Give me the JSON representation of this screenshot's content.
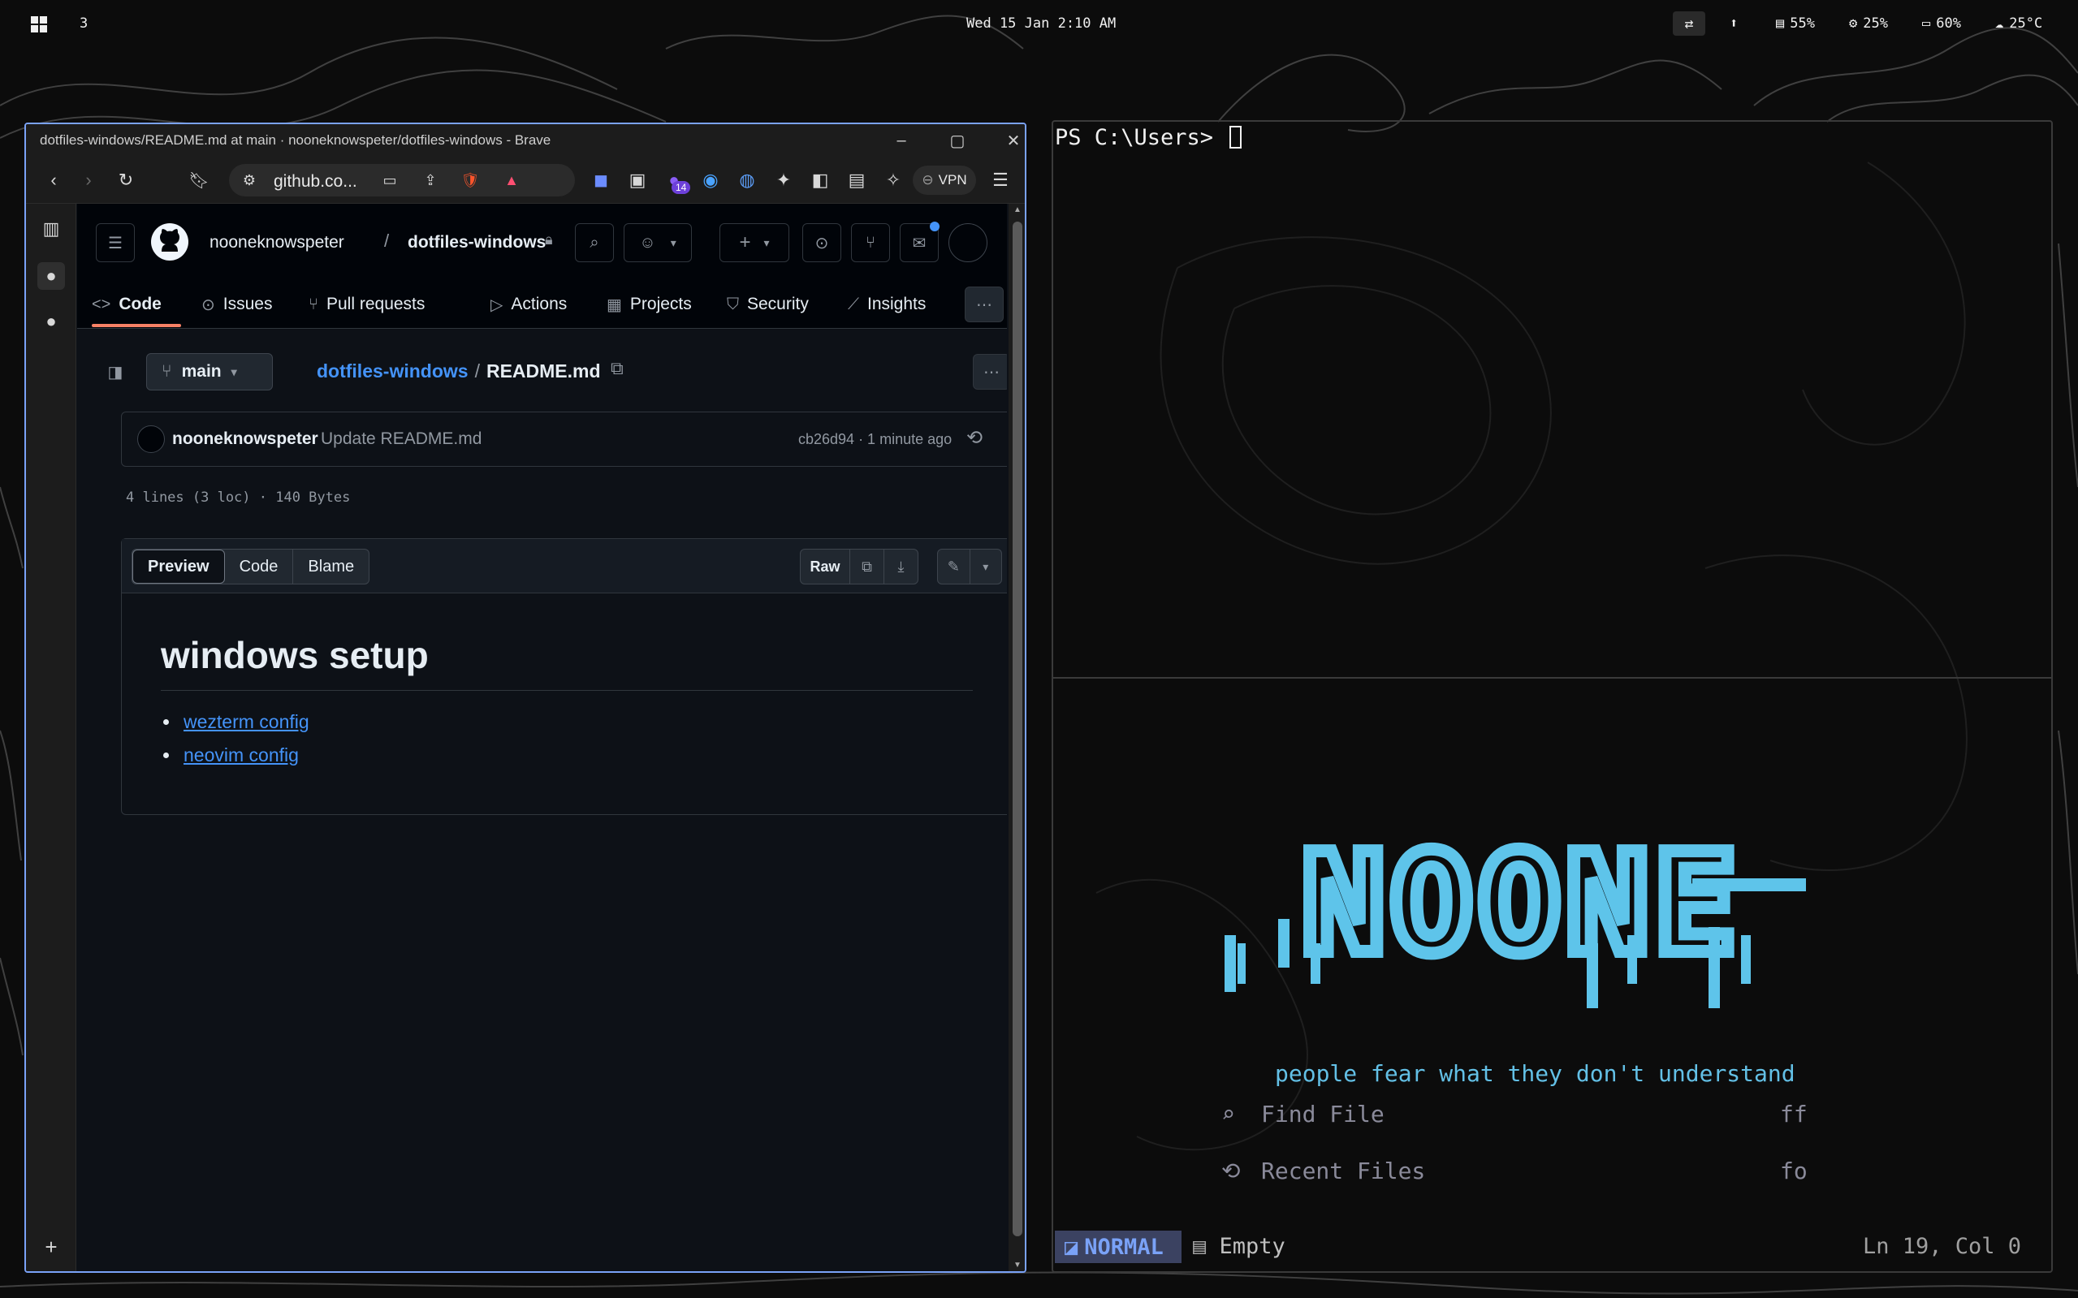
{
  "topbar": {
    "workspace": "3",
    "clock": "Wed 15 Jan 2:10 AM",
    "memory": "55%",
    "cpu": "25%",
    "battery": "60%",
    "weather": "25°C"
  },
  "browser": {
    "window_title": "dotfiles-windows/README.md at main · nooneknowspeter/dotfiles-windows - Brave",
    "url": "github.co...",
    "vpn_label": "VPN",
    "extension_badge": "14"
  },
  "github": {
    "owner": "nooneknowspeter",
    "repo": "dotfiles-windows",
    "tabs": [
      {
        "label": "Code"
      },
      {
        "label": "Issues"
      },
      {
        "label": "Pull requests"
      },
      {
        "label": "Actions"
      },
      {
        "label": "Projects"
      },
      {
        "label": "Security"
      },
      {
        "label": "Insights"
      }
    ],
    "branch": "main",
    "breadcrumb_repo": "dotfiles-windows",
    "breadcrumb_sep": "/",
    "breadcrumb_file": "README.md",
    "commit": {
      "author": "nooneknowspeter",
      "message": "Update README.md",
      "meta": "cb26d94 · 1 minute ago"
    },
    "file_meta": "4 lines (3 loc) · 140 Bytes",
    "view_tabs": [
      "Preview",
      "Code",
      "Blame"
    ],
    "raw_label": "Raw",
    "readme": {
      "heading": "windows setup",
      "links": [
        "wezterm config",
        "neovim config"
      ]
    }
  },
  "terminal": {
    "prompt": "PS C:\\Users> ",
    "logo_text": "NOONE",
    "tagline": "people fear what they don't understand",
    "menu": [
      {
        "label": "Find File",
        "key": "ff",
        "icon": "search-icon"
      },
      {
        "label": "Recent Files",
        "key": "fo",
        "icon": "history-icon"
      }
    ],
    "status": {
      "mode": "NORMAL",
      "file": "Empty",
      "position": "Ln 19, Col 0"
    }
  },
  "colors": {
    "accent": "#7aa2f7",
    "logo": "#5ec4ea",
    "github_link": "#4493f8",
    "tab_underline": "#f78166"
  }
}
